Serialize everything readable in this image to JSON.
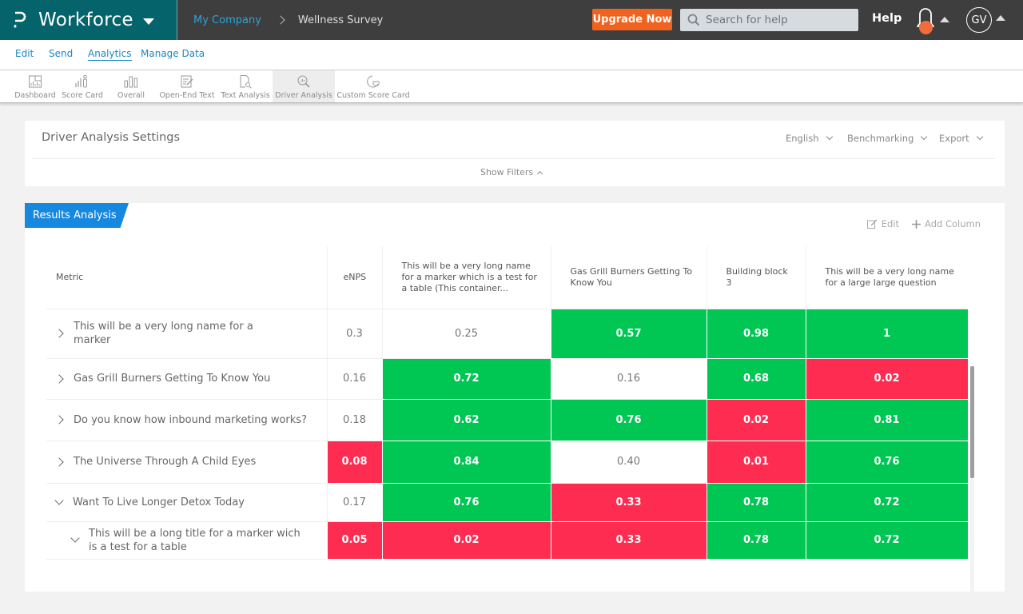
{
  "topbar": {
    "app_name": "Workforce",
    "breadcrumb": [
      {
        "label": "My Company"
      },
      {
        "label": "Wellness Survey"
      }
    ],
    "upgrade_label": "Upgrade Now",
    "search_placeholder": "Search for help",
    "help_label": "Help",
    "avatar_initials": "GV",
    "colors": {
      "brand": "#04636b",
      "upgrade": "#f2621f",
      "notification_dot": "#f26c3d"
    }
  },
  "subnav": {
    "items": [
      {
        "label": "Edit"
      },
      {
        "label": "Send"
      },
      {
        "label": "Analytics",
        "active": true
      },
      {
        "label": "Manage Data"
      }
    ]
  },
  "toolbar": {
    "items": [
      {
        "label": "Dashboard",
        "icon": "dashboard-icon"
      },
      {
        "label": "Score Card",
        "icon": "score-card-icon"
      },
      {
        "label": "Overall",
        "icon": "bar-chart-icon"
      },
      {
        "label": "Open-End Text",
        "icon": "notepad-icon"
      },
      {
        "label": "Text Analysis",
        "icon": "document-search-icon"
      },
      {
        "label": "Driver Analysis",
        "icon": "magnifier-chart-icon",
        "active": true
      },
      {
        "label": "Custom Score Card",
        "icon": "pie-icon"
      }
    ]
  },
  "settings": {
    "title": "Driver Analysis Settings",
    "language": "English",
    "benchmarking": "Benchmarking",
    "export": "Export",
    "show_filters": "Show Filters"
  },
  "results": {
    "tab_label": "Results Analysis",
    "edit_label": "Edit",
    "add_column_label": "Add Column",
    "colors": {
      "positive": "#00c753",
      "negative": "#fe2c50",
      "tab": "#1788e0"
    },
    "columns": [
      "Metric",
      "eNPS",
      "This will be a very long name for a marker which is a test for a table (This container...",
      "Gas Grill Burners Getting To Know You",
      "Building block 3",
      "This will be a very long name for a large large question"
    ],
    "rows": [
      {
        "metric": "This will be a very long name for a marker",
        "expanded": false,
        "level": 0,
        "cells": [
          {
            "v": "0.3",
            "s": ""
          },
          {
            "v": "0.25",
            "s": ""
          },
          {
            "v": "0.57",
            "s": "pos"
          },
          {
            "v": "0.98",
            "s": "pos"
          },
          {
            "v": "1",
            "s": "pos"
          }
        ]
      },
      {
        "metric": "Gas Grill Burners Getting To Know You",
        "expanded": false,
        "level": 0,
        "cells": [
          {
            "v": "0.16",
            "s": ""
          },
          {
            "v": "0.72",
            "s": "pos"
          },
          {
            "v": "0.16",
            "s": ""
          },
          {
            "v": "0.68",
            "s": "pos"
          },
          {
            "v": "0.02",
            "s": "neg"
          }
        ]
      },
      {
        "metric": "Do you know how inbound marketing works?",
        "expanded": false,
        "level": 0,
        "cells": [
          {
            "v": "0.18",
            "s": ""
          },
          {
            "v": "0.62",
            "s": "pos"
          },
          {
            "v": "0.76",
            "s": "pos"
          },
          {
            "v": "0.02",
            "s": "neg"
          },
          {
            "v": "0.81",
            "s": "pos"
          }
        ]
      },
      {
        "metric": "The Universe Through A Child Eyes",
        "expanded": false,
        "level": 0,
        "cells": [
          {
            "v": "0.08",
            "s": "neg"
          },
          {
            "v": "0.84",
            "s": "pos"
          },
          {
            "v": "0.40",
            "s": ""
          },
          {
            "v": "0.01",
            "s": "neg"
          },
          {
            "v": "0.76",
            "s": "pos"
          }
        ]
      },
      {
        "metric": "Want To Live Longer Detox Today",
        "expanded": true,
        "level": 0,
        "cells": [
          {
            "v": "0.17",
            "s": ""
          },
          {
            "v": "0.76",
            "s": "pos"
          },
          {
            "v": "0.33",
            "s": "neg"
          },
          {
            "v": "0.78",
            "s": "pos"
          },
          {
            "v": "0.72",
            "s": "pos"
          }
        ]
      },
      {
        "metric": "This will be a long title for a marker wich is a test for a table",
        "expanded": true,
        "level": 1,
        "cells": [
          {
            "v": "0.05",
            "s": "neg"
          },
          {
            "v": "0.02",
            "s": "neg"
          },
          {
            "v": "0.33",
            "s": "neg"
          },
          {
            "v": "0.78",
            "s": "pos"
          },
          {
            "v": "0.72",
            "s": "pos"
          }
        ]
      }
    ]
  }
}
